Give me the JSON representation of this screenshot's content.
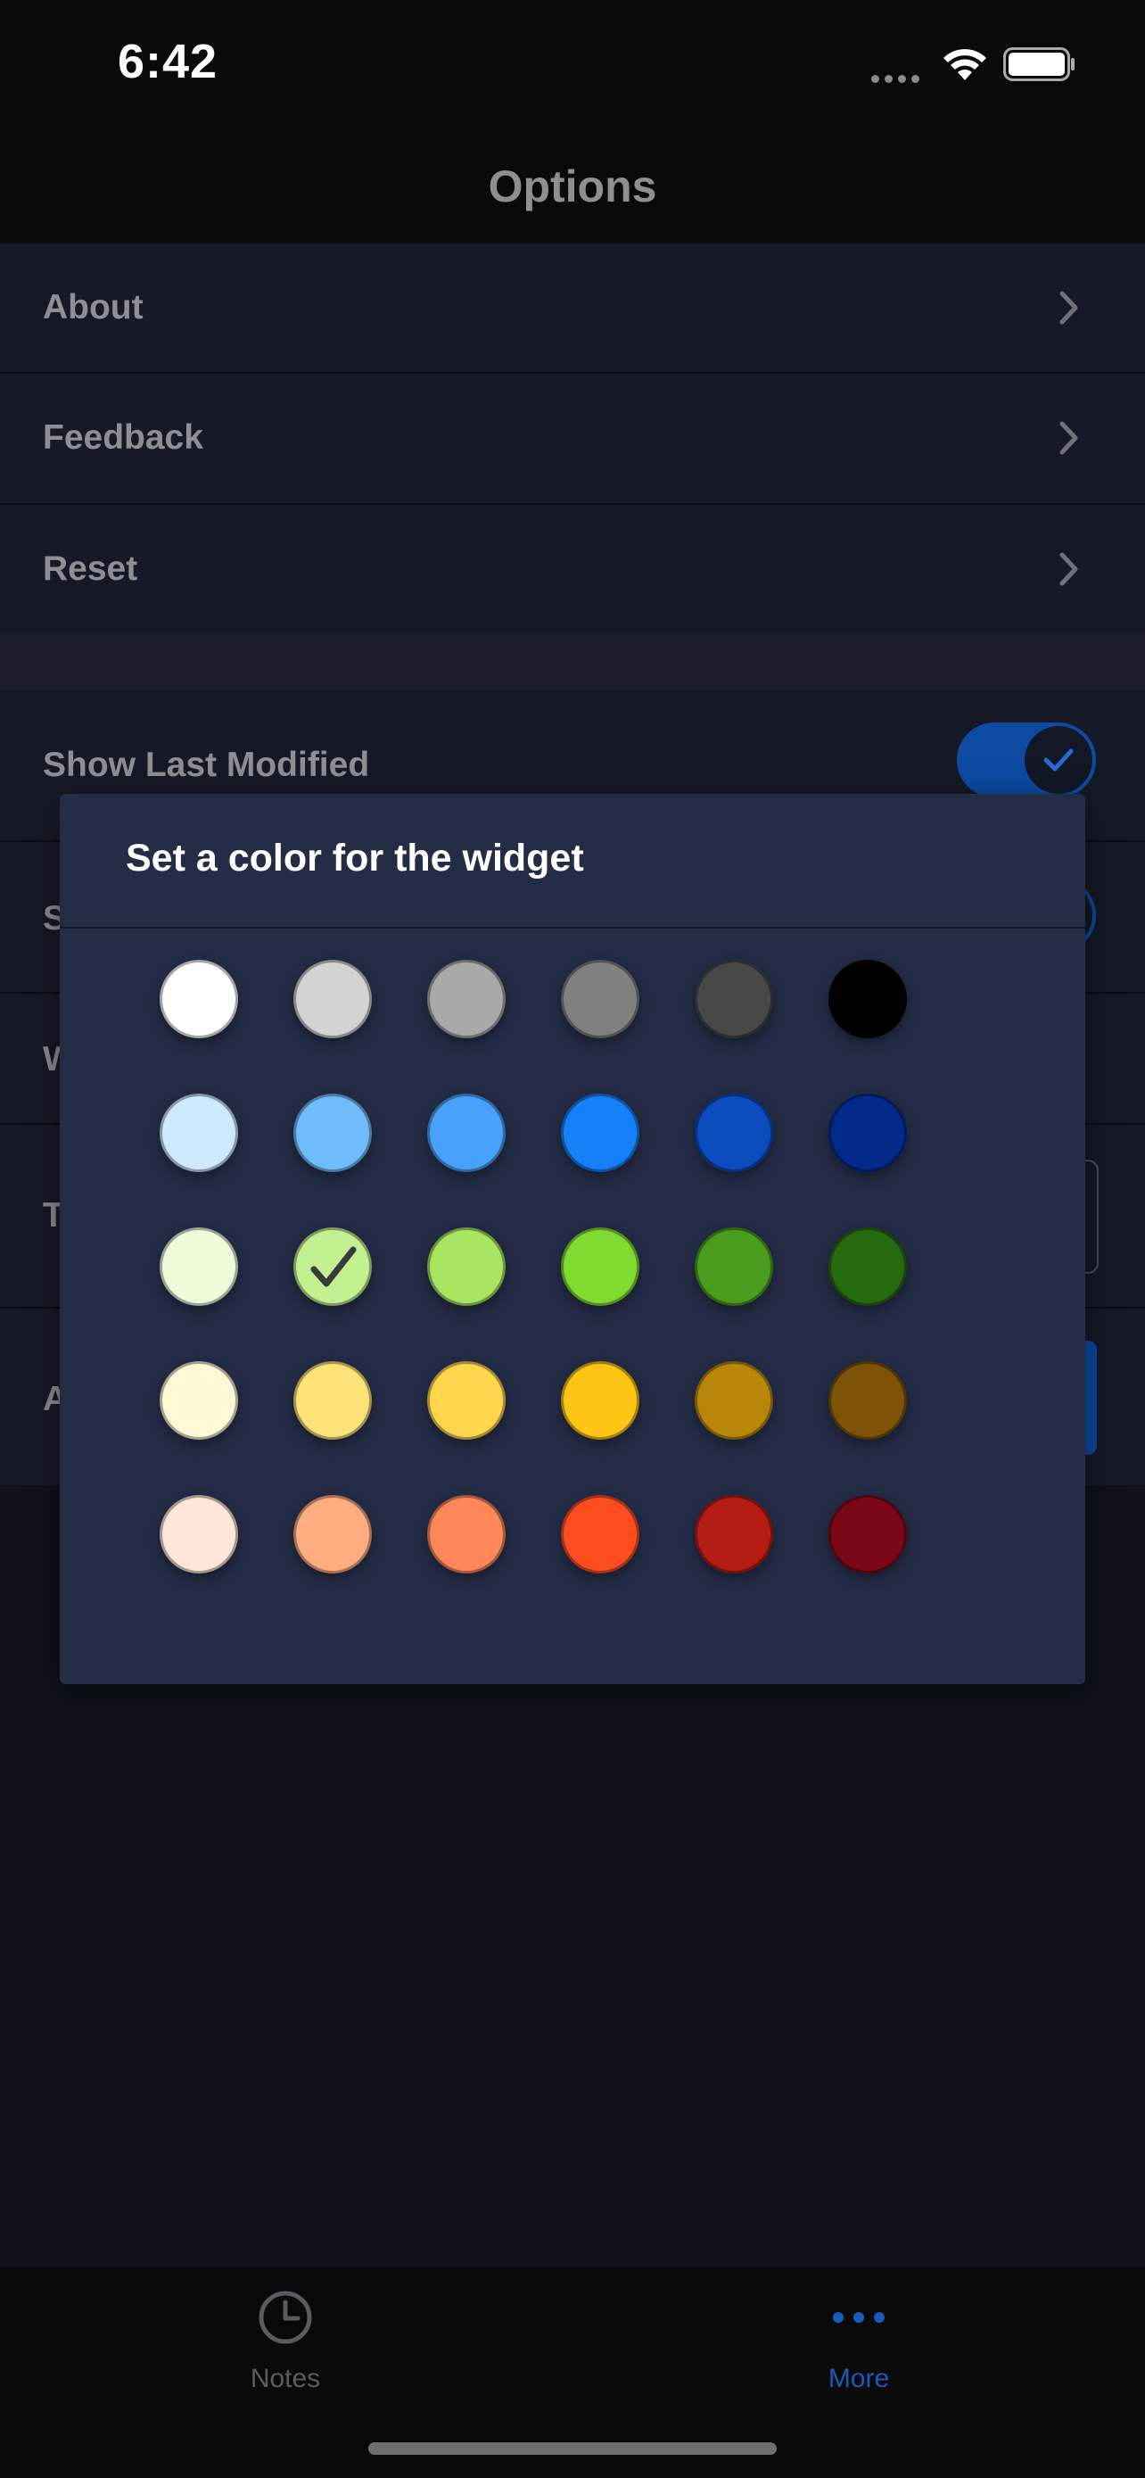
{
  "status_bar": {
    "time": "6:42"
  },
  "nav": {
    "title": "Options"
  },
  "list": {
    "items": [
      {
        "label": "About"
      },
      {
        "label": "Feedback"
      },
      {
        "label": "Reset"
      }
    ],
    "toggle_rows": [
      {
        "label": "Show Last Modified",
        "on": true
      },
      {
        "label": "S",
        "on": true
      }
    ],
    "partial_rows": [
      {
        "label": "W"
      },
      {
        "label": "T"
      },
      {
        "label": "A"
      }
    ]
  },
  "dialog": {
    "title": "Set a color for the widget",
    "selected": "#c2ef90",
    "swatches": [
      [
        "#ffffff",
        "#d3d3d3",
        "#a9a9a9",
        "#808080",
        "#484848",
        "#000000"
      ],
      [
        "#cce9ff",
        "#70bcfb",
        "#48a1fa",
        "#1580f7",
        "#0b4cbf",
        "#032a8a"
      ],
      [
        "#eefbdb",
        "#c2ef90",
        "#a7e45f",
        "#80db30",
        "#4a9d1c",
        "#276b10"
      ],
      [
        "#fff7d6",
        "#fee378",
        "#ffd64d",
        "#ffc514",
        "#b8860b",
        "#7d5407"
      ],
      [
        "#ffe6da",
        "#ffac82",
        "#ff875a",
        "#ff4d22",
        "#b51d14",
        "#7b0817"
      ]
    ]
  },
  "tab_bar": {
    "tabs": [
      {
        "label": "Notes",
        "icon": "clock-icon",
        "active": false
      },
      {
        "label": "More",
        "icon": "ellipsis-icon",
        "active": true
      }
    ],
    "active_color": "#1a5ab8",
    "inactive_color": "#5a5b60"
  }
}
